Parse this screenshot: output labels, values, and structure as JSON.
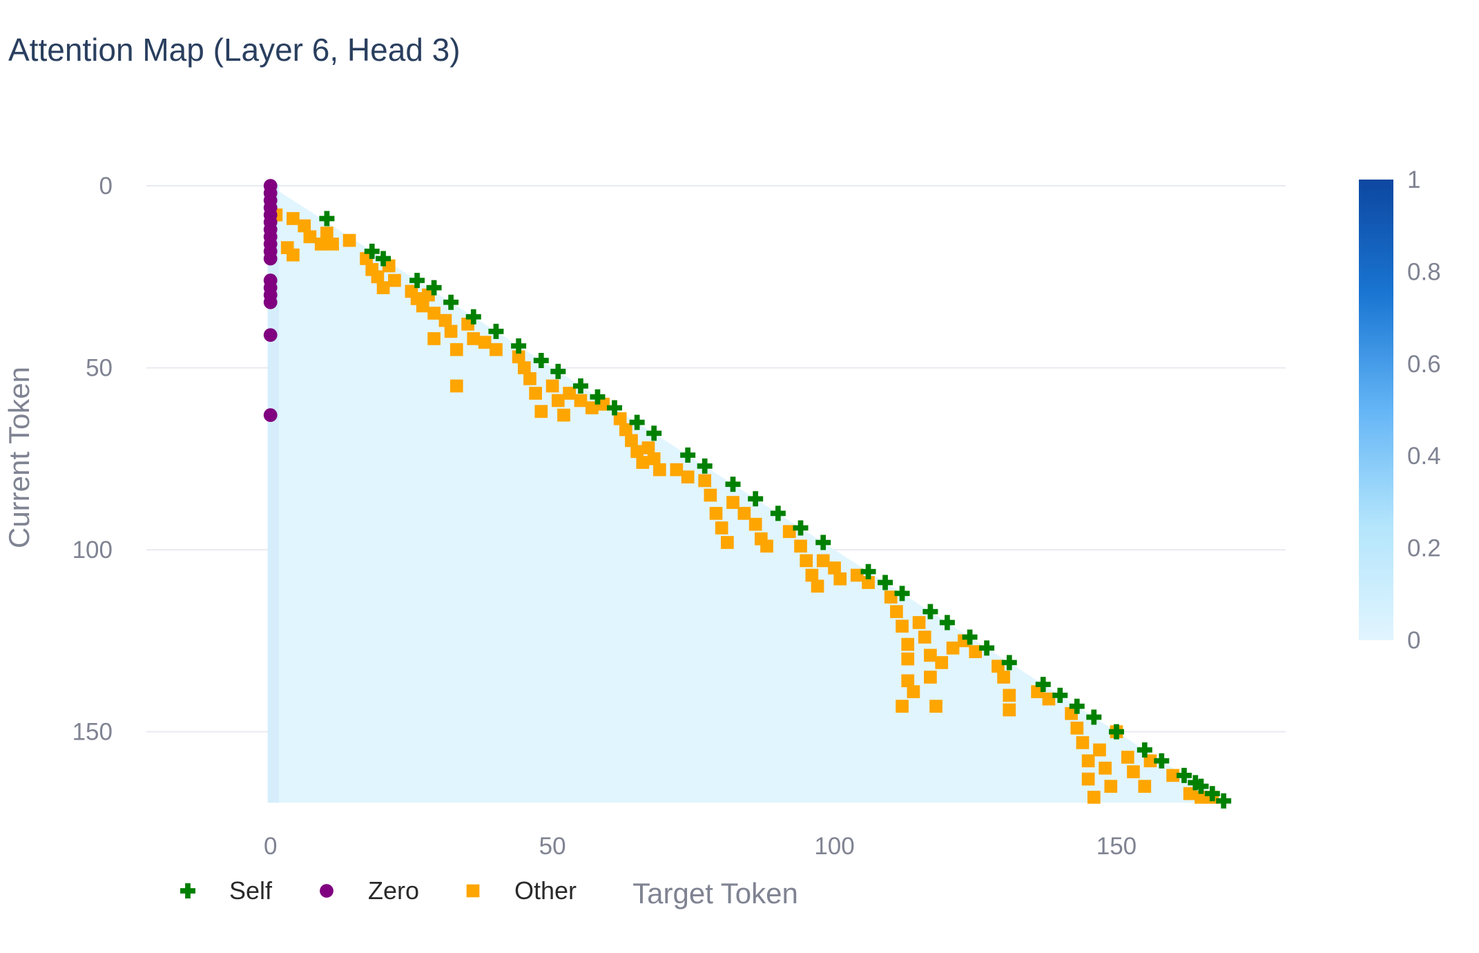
{
  "chart_data": {
    "type": "heatmap",
    "title": "Attention Map (Layer 6, Head 3)",
    "xlabel": "Target Token",
    "ylabel": "Current Token",
    "x_ticks": [
      "0",
      "50",
      "100",
      "150"
    ],
    "y_ticks": [
      "0",
      "50",
      "100",
      "150"
    ],
    "xlim": [
      -22,
      180
    ],
    "ylim": [
      -15,
      170
    ],
    "y_reversed": true,
    "n_tokens": 170,
    "colorscale": [
      "#e1f5fe",
      "#b3e5fc",
      "#64b5f6",
      "#1976d2",
      "#0d47a1"
    ],
    "colorbar": {
      "min": 0,
      "max": 1,
      "ticks": [
        "0",
        "0.2",
        "0.4",
        "0.6",
        "0.8",
        "1"
      ]
    },
    "grid": true,
    "legend_position": "bottom-left",
    "series": [
      {
        "name": "Self",
        "color": "#008000",
        "marker": "cross",
        "points": [
          [
            10,
            9
          ],
          [
            18,
            18
          ],
          [
            20,
            20
          ],
          [
            26,
            26
          ],
          [
            29,
            28
          ],
          [
            32,
            32
          ],
          [
            36,
            36
          ],
          [
            40,
            40
          ],
          [
            44,
            44
          ],
          [
            48,
            48
          ],
          [
            51,
            51
          ],
          [
            55,
            55
          ],
          [
            58,
            58
          ],
          [
            61,
            61
          ],
          [
            65,
            65
          ],
          [
            68,
            68
          ],
          [
            74,
            74
          ],
          [
            77,
            77
          ],
          [
            82,
            82
          ],
          [
            86,
            86
          ],
          [
            90,
            90
          ],
          [
            94,
            94
          ],
          [
            98,
            98
          ],
          [
            106,
            106
          ],
          [
            109,
            109
          ],
          [
            112,
            112
          ],
          [
            117,
            117
          ],
          [
            120,
            120
          ],
          [
            124,
            124
          ],
          [
            127,
            127
          ],
          [
            131,
            131
          ],
          [
            137,
            137
          ],
          [
            140,
            140
          ],
          [
            143,
            143
          ],
          [
            146,
            146
          ],
          [
            150,
            150
          ],
          [
            155,
            155
          ],
          [
            158,
            158
          ],
          [
            162,
            162
          ],
          [
            164,
            164
          ],
          [
            165,
            165
          ],
          [
            167,
            167
          ],
          [
            169,
            169
          ]
        ]
      },
      {
        "name": "Zero",
        "color": "#800080",
        "marker": "circle",
        "points": [
          [
            0,
            0
          ],
          [
            0,
            2
          ],
          [
            0,
            4
          ],
          [
            0,
            6
          ],
          [
            0,
            8
          ],
          [
            0,
            10
          ],
          [
            0,
            12
          ],
          [
            0,
            14
          ],
          [
            0,
            16
          ],
          [
            0,
            18
          ],
          [
            0,
            20
          ],
          [
            0,
            26
          ],
          [
            0,
            28
          ],
          [
            0,
            30
          ],
          [
            0,
            32
          ],
          [
            0,
            41
          ],
          [
            0,
            63
          ]
        ]
      },
      {
        "name": "Other",
        "color": "#ffa500",
        "marker": "square",
        "points": [
          [
            1,
            8
          ],
          [
            3,
            17
          ],
          [
            4,
            9
          ],
          [
            4,
            19
          ],
          [
            6,
            11
          ],
          [
            7,
            14
          ],
          [
            9,
            16
          ],
          [
            10,
            13
          ],
          [
            11,
            16
          ],
          [
            14,
            15
          ],
          [
            17,
            20
          ],
          [
            18,
            23
          ],
          [
            19,
            25
          ],
          [
            20,
            28
          ],
          [
            21,
            22
          ],
          [
            22,
            26
          ],
          [
            25,
            29
          ],
          [
            26,
            31
          ],
          [
            27,
            33
          ],
          [
            28,
            30
          ],
          [
            29,
            35
          ],
          [
            29,
            42
          ],
          [
            31,
            37
          ],
          [
            32,
            40
          ],
          [
            33,
            45
          ],
          [
            33,
            55
          ],
          [
            35,
            38
          ],
          [
            36,
            42
          ],
          [
            38,
            43
          ],
          [
            40,
            45
          ],
          [
            44,
            47
          ],
          [
            45,
            50
          ],
          [
            46,
            53
          ],
          [
            47,
            57
          ],
          [
            48,
            62
          ],
          [
            50,
            55
          ],
          [
            51,
            59
          ],
          [
            52,
            63
          ],
          [
            53,
            57
          ],
          [
            55,
            59
          ],
          [
            57,
            61
          ],
          [
            59,
            60
          ],
          [
            62,
            64
          ],
          [
            63,
            67
          ],
          [
            64,
            70
          ],
          [
            65,
            73
          ],
          [
            66,
            76
          ],
          [
            67,
            72
          ],
          [
            68,
            75
          ],
          [
            69,
            78
          ],
          [
            72,
            78
          ],
          [
            74,
            80
          ],
          [
            77,
            81
          ],
          [
            78,
            85
          ],
          [
            79,
            90
          ],
          [
            80,
            94
          ],
          [
            81,
            98
          ],
          [
            82,
            87
          ],
          [
            84,
            90
          ],
          [
            86,
            93
          ],
          [
            87,
            97
          ],
          [
            88,
            99
          ],
          [
            92,
            95
          ],
          [
            94,
            99
          ],
          [
            95,
            103
          ],
          [
            96,
            107
          ],
          [
            97,
            110
          ],
          [
            98,
            103
          ],
          [
            100,
            105
          ],
          [
            101,
            108
          ],
          [
            104,
            107
          ],
          [
            106,
            109
          ],
          [
            110,
            113
          ],
          [
            111,
            117
          ],
          [
            112,
            121
          ],
          [
            113,
            126
          ],
          [
            113,
            130
          ],
          [
            113,
            136
          ],
          [
            112,
            143
          ],
          [
            114,
            139
          ],
          [
            115,
            120
          ],
          [
            116,
            124
          ],
          [
            117,
            129
          ],
          [
            117,
            135
          ],
          [
            118,
            143
          ],
          [
            119,
            131
          ],
          [
            121,
            127
          ],
          [
            123,
            125
          ],
          [
            125,
            128
          ],
          [
            129,
            132
          ],
          [
            130,
            135
          ],
          [
            131,
            140
          ],
          [
            131,
            144
          ],
          [
            136,
            139
          ],
          [
            138,
            141
          ],
          [
            142,
            145
          ],
          [
            143,
            149
          ],
          [
            144,
            153
          ],
          [
            145,
            158
          ],
          [
            145,
            163
          ],
          [
            146,
            168
          ],
          [
            147,
            155
          ],
          [
            148,
            160
          ],
          [
            149,
            165
          ],
          [
            150,
            150
          ],
          [
            152,
            157
          ],
          [
            153,
            161
          ],
          [
            155,
            165
          ],
          [
            156,
            158
          ],
          [
            160,
            162
          ],
          [
            163,
            167
          ],
          [
            165,
            168
          ],
          [
            167,
            168
          ]
        ]
      }
    ]
  }
}
